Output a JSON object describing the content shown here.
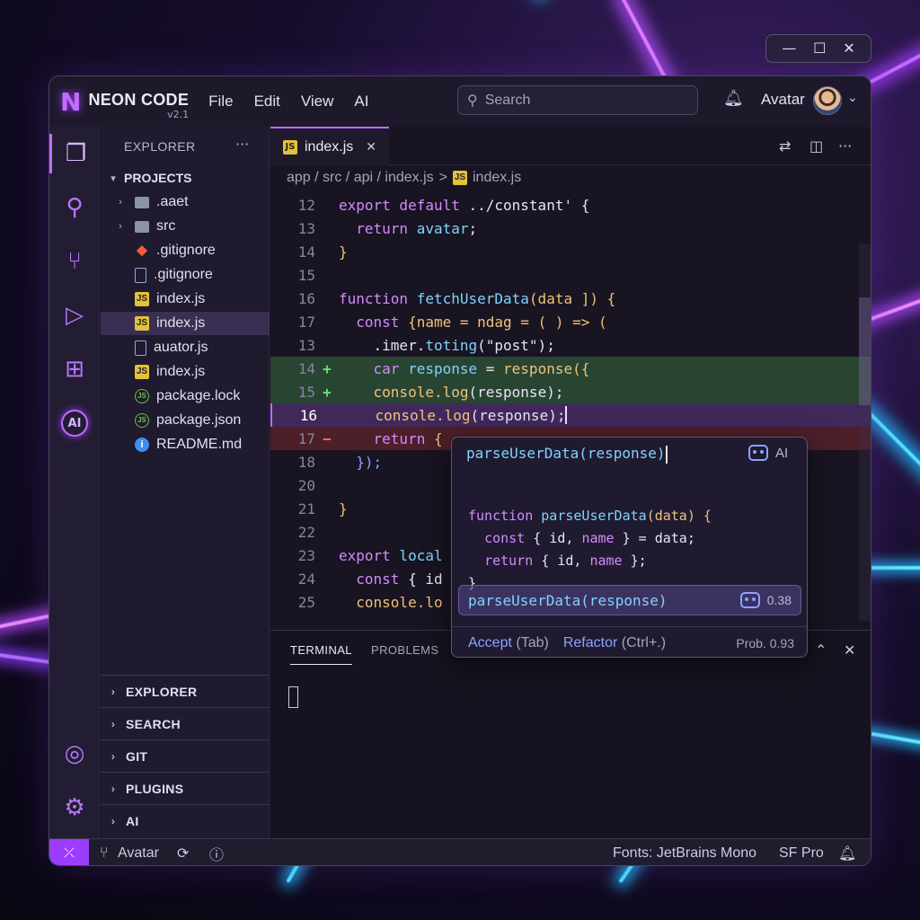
{
  "window_controls": {
    "minimize": "—",
    "maximize": "☐",
    "close": "✕"
  },
  "app": {
    "logo": "N",
    "name": "NEON CODE",
    "version": "v2.1"
  },
  "menu": [
    "File",
    "Edit",
    "View",
    "AI"
  ],
  "search": {
    "placeholder": "Search"
  },
  "user": {
    "name": "Avatar"
  },
  "sidebar": {
    "title": "EXPLORER",
    "more": "···",
    "root": "PROJECTS",
    "items": [
      {
        "label": ".aaet",
        "type": "folder"
      },
      {
        "label": "src",
        "type": "folder"
      },
      {
        "label": ".gitignore",
        "type": "git"
      },
      {
        "label": ".gitignore",
        "type": "file"
      },
      {
        "label": "index.js",
        "type": "js"
      },
      {
        "label": "index.js",
        "type": "js"
      },
      {
        "label": "auator.js",
        "type": "file"
      },
      {
        "label": "index.js",
        "type": "js"
      },
      {
        "label": "package.lock",
        "type": "node"
      },
      {
        "label": "package.json",
        "type": "node"
      },
      {
        "label": "README.md",
        "type": "info"
      }
    ],
    "sections": [
      "EXPLORER",
      "SEARCH",
      "GIT",
      "PLUGINS",
      "AI"
    ]
  },
  "activity_bar": {
    "ai_label": "AI"
  },
  "editor": {
    "tab": {
      "icon": "JS",
      "label": "index.js"
    },
    "breadcrumb": {
      "path": "app / src / api / index.js",
      "sep": ">",
      "icon": "JS",
      "file": "index.js"
    },
    "lines": [
      {
        "n": "12",
        "text": "export default ../constant' {"
      },
      {
        "n": "13",
        "text": "  return avatar;"
      },
      {
        "n": "14",
        "text": "}"
      },
      {
        "n": "15",
        "text": ""
      },
      {
        "n": "16",
        "text": "function fetchUserData(data ]) {"
      },
      {
        "n": "17",
        "text": "  const {name = ndag = ( ) => ("
      },
      {
        "n": "13",
        "text": "    .imer.toting(\"post\");"
      },
      {
        "n": "14",
        "text": "    car response = response({"
      },
      {
        "n": "15",
        "text": "    console.log(response);"
      },
      {
        "n": "16",
        "text": "    console.log(response);"
      },
      {
        "n": "17",
        "text": "    return {"
      },
      {
        "n": "18",
        "text": "  });"
      },
      {
        "n": "20",
        "text": ""
      },
      {
        "n": "21",
        "text": "}"
      },
      {
        "n": "22",
        "text": ""
      },
      {
        "n": "23",
        "text": "export local"
      },
      {
        "n": "24",
        "text": "  const { id"
      },
      {
        "n": "25",
        "text": "  console.lo"
      }
    ],
    "gutter_add": "+",
    "gutter_remove": "−"
  },
  "autocomplete": {
    "input": "parseUserData(response)",
    "ai_label": "AI",
    "code": [
      "function parseUserData(data) {",
      "  const { id, name } = data;",
      "  return { id, name };",
      "}"
    ],
    "suggestion": "parseUserData(response)",
    "score": "0.38",
    "accept": "Accept",
    "accept_hint": "(Tab)",
    "refactor": "Refactor",
    "refactor_hint": "(Ctrl+.)",
    "prob": "Prob. 0.93"
  },
  "panel": {
    "tabs": [
      "TERMINAL",
      "PROBLEMS"
    ]
  },
  "status": {
    "branch": "Avatar",
    "fonts": "Fonts: JetBrains Mono",
    "font2": "SF Pro"
  },
  "colors": {
    "accent": "#c46bff",
    "add": "#2f6e42",
    "remove": "#782832",
    "current": "#693c96"
  }
}
